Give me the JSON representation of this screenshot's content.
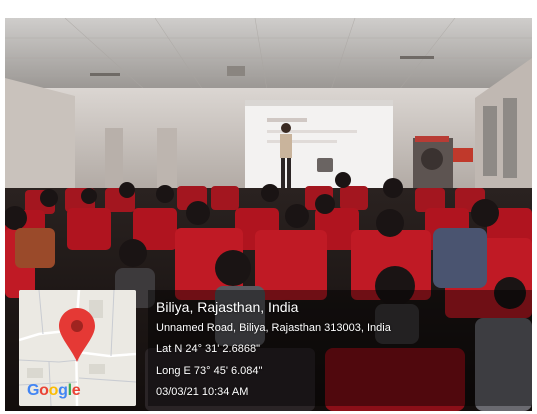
{
  "caption": {
    "place": "Biliya, Rajasthan, India",
    "address": "Unnamed Road, Biliya, Rajasthan 313003, India",
    "latitude": "Lat N 24° 31' 2.6868\"",
    "longitude": "Long E 73° 45' 6.084\"",
    "datetime": "03/03/21 10:34 AM"
  },
  "map": {
    "logo_text": "Google",
    "pin_icon": "map-pin-icon",
    "logo_letter_colors": [
      "#4285f4",
      "#ea4335",
      "#fbbc05",
      "#4285f4",
      "#34a853",
      "#ea4335"
    ],
    "pin_color": "#e53935"
  },
  "photo": {
    "subject": "lecture-hall-projector-presentation"
  }
}
